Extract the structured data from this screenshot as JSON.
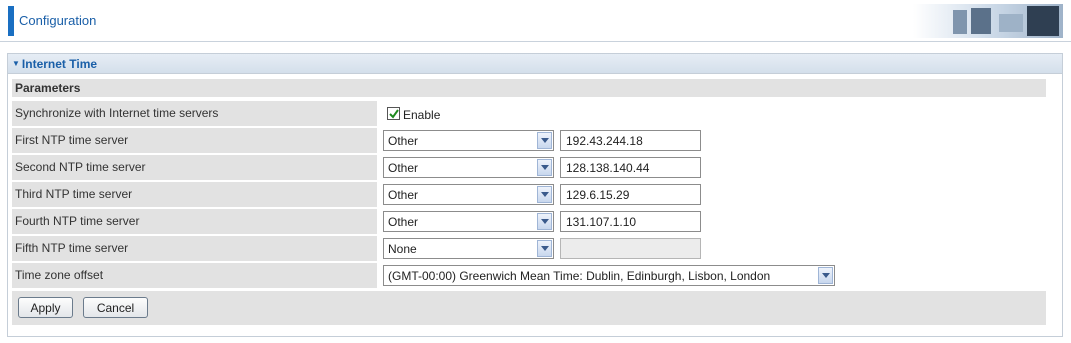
{
  "header": {
    "title": "Configuration"
  },
  "section": {
    "title": "Internet Time",
    "params_label": "Parameters"
  },
  "sync": {
    "label": "Synchronize with Internet time servers",
    "checkbox_label": "Enable",
    "checked": true
  },
  "ntp_rows": [
    {
      "label": "First NTP time server",
      "select_value": "Other",
      "input_value": "192.43.244.18"
    },
    {
      "label": "Second NTP time server",
      "select_value": "Other",
      "input_value": "128.138.140.44"
    },
    {
      "label": "Third NTP time server",
      "select_value": "Other",
      "input_value": "129.6.15.29"
    },
    {
      "label": "Fourth NTP time server",
      "select_value": "Other",
      "input_value": "131.107.1.10"
    },
    {
      "label": "Fifth NTP time server",
      "select_value": "None",
      "input_value": ""
    }
  ],
  "timezone": {
    "label": "Time zone offset",
    "select_value": "(GMT-00:00) Greenwich Mean Time: Dublin, Edinburgh, Lisbon, London"
  },
  "buttons": {
    "apply": "Apply",
    "cancel": "Cancel"
  },
  "colors": {
    "accent": "#1a6fc2",
    "label_bg": "#e2e2e2",
    "title_text": "#1a5fa8"
  }
}
